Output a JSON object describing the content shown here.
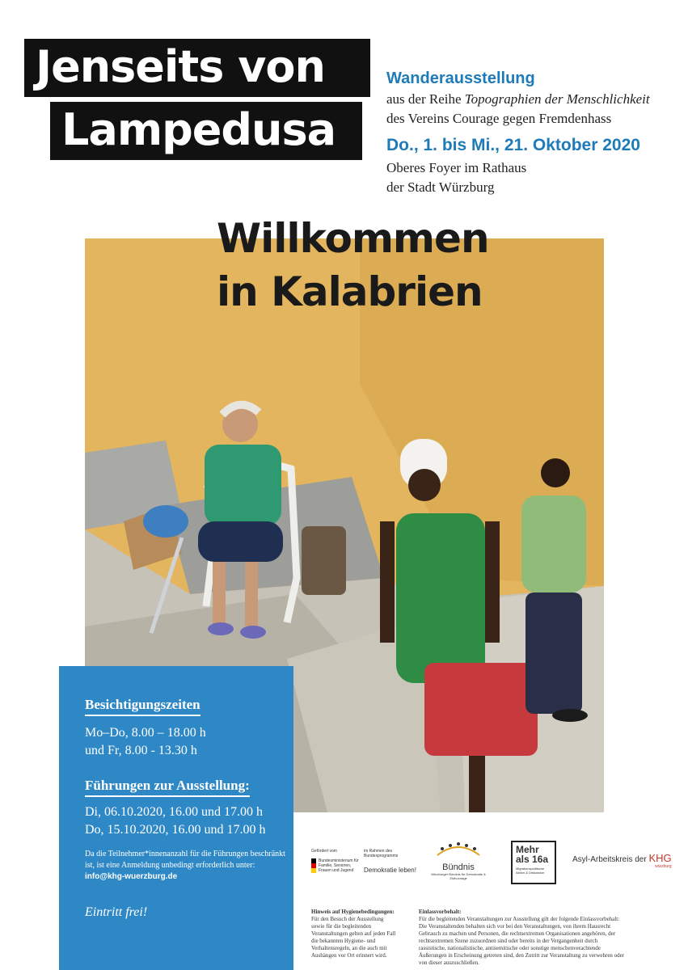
{
  "title": {
    "line1": "Jenseits von",
    "line2": "Lampedusa"
  },
  "info": {
    "exhibition": "Wanderausstellung",
    "series_prefix": "aus der Reihe ",
    "series_title": "Topographien der Menschlichkeit",
    "association": "des Vereins Courage gegen Fremdenhass",
    "dates": "Do., 1. bis Mi., 21. Oktober 2020",
    "venue_line1": "Oberes Foyer im Rathaus",
    "venue_line2": "der Stadt Würzburg"
  },
  "headline": {
    "line1": "Willkommen",
    "line2": "in Kalabrien"
  },
  "schedule": {
    "heading": "Besichtigungszeiten",
    "line1": "Mo–Do, 8.00 – 18.00 h",
    "line2": "und Fr, 8.00 - 13.30 h",
    "tours_heading": "Führungen zur Ausstellung:",
    "tour1": "Di, 06.10.2020, 16.00 und 17.00 h",
    "tour2": "Do, 15.10.2020, 16.00 und 17.00 h",
    "note": "Da die Teilnehmer*innenanzahl für die Führungen beschränkt ist, ist eine Anmeldung unbedingt erforderlich unter: ",
    "email": "info@khg-wuerzburg.de",
    "entry": "Eintritt frei!"
  },
  "logos": {
    "bmfsfj_caption": "Gefördert vom",
    "bmfsfj_name": "Bundesministerium für Familie, Senioren, Frauen und Jugend",
    "demokratie_caption": "im Rahmen des Bundesprogramms",
    "demokratie_name": "Demokratie leben!",
    "buendnis": "Bündnis",
    "buendnis_sub": "Würzburger Bündnis für Demokratie & Zivilcourage",
    "mehr_line1": "Mehr",
    "mehr_line2": "als 16a",
    "mehr_sub": "Migrationspolitische Aktion & Diskussion",
    "asyl": "Asyl-Arbeitskreis der",
    "khg": "KHG",
    "khg_sub": "würzburg"
  },
  "fineprint": {
    "hygiene_heading": "Hinweis auf Hygienebedingungen:",
    "hygiene_text": "Für den Besuch der Ausstellung sowie für die begleitenden Veranstaltungen gelten auf jeden Fall die bekannten Hygiene- und Verhaltensregeln, an die auch mit Aushängen vor Ort erinnert wird.",
    "einlass_heading": "Einlassvorbehalt:",
    "einlass_text": "Für die begleitenden Veranstaltungen zur Ausstellung gilt der folgende Einlassvorbehalt: Die Veranstaltenden behalten sich vor bei den Veranstaltungen, von ihrem Hausrecht Gebrauch zu machen und Personen, die rechtsextremen Organisationen angehören, der rechtsextremen Szene zuzuordnen sind oder bereits in der Vergangenheit durch rassistische, nationalistische, antisemitische oder sonstige menschenverachtende Äußerungen in Erscheinung getreten sind, den Zutritt zur Veranstaltung zu verwehren oder von dieser auszuschließen."
  },
  "colors": {
    "accent_blue": "#2f88c6",
    "title_blue": "#1f7ab8",
    "wall_yellow": "#e2b55e"
  }
}
